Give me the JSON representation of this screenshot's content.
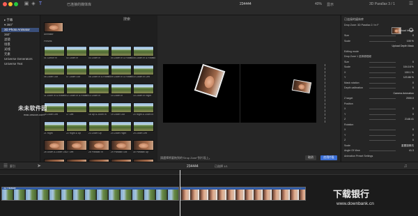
{
  "colors": {
    "accent": "#3b6fd6",
    "selection": "#3a4f7a",
    "clip": "#2e5aa6",
    "timecode": "#9a9a9a"
  },
  "titlebar": {
    "library_title": "已连接的媒体库",
    "timecode": "234444",
    "zoom": "40%",
    "view_label": "显示",
    "inspector_title": "3D Parallax 3 / 1"
  },
  "sidebar": {
    "items": [
      {
        "label": "字幕",
        "icon": "text-icon"
      },
      {
        "label": "360°",
        "icon": "globe-icon"
      },
      {
        "label": "3D Photo Animator",
        "icon": "folder-icon"
      },
      {
        "label": "360°"
      },
      {
        "label": "滤镜"
      },
      {
        "label": "场景"
      },
      {
        "label": "光线"
      },
      {
        "label": "元素"
      },
      {
        "label": "Universe Generators"
      },
      {
        "label": "Universe Text"
      }
    ]
  },
  "browser": {
    "search_placeholder": "搜索",
    "preview_label": "Animator",
    "section": "Presets",
    "rows": [
      {
        "kind": "land",
        "captions": [
          "01 Cursor In",
          "02 Zoom In",
          "03 Zoom In",
          "04 Zoom In & Rotation Right",
          "05 Zoom In & Rotation Right"
        ]
      },
      {
        "kind": "land",
        "captions": [
          "06 Zoom Out",
          "07 Zoom Out",
          "08 Zoom In & Rotation Left",
          "09 Zoom In & Rotation Left",
          "10 Zoom In Left"
        ]
      },
      {
        "kind": "land",
        "captions": [
          "11 Zoom In & Rotation",
          "12 Zoom In & Rotation",
          "13 Zoom In",
          "14 Zoom In",
          "15 Zoom In Right"
        ]
      },
      {
        "kind": "land",
        "captions": [
          "16 Zoom Left",
          "17 Left",
          "18 Up & Zoom In",
          "19 Zoom Out",
          "20 Right & Zoom In"
        ]
      },
      {
        "kind": "land",
        "captions": [
          "21 Right",
          "22 Right & Up",
          "23 Zoom Up",
          "24 Zoom Right",
          "25 Zoom Left"
        ]
      },
      {
        "kind": "face",
        "captions": [
          "26 Down & Zoom Out",
          "27 Left",
          "28 Parallax In",
          "29 Parallax Out",
          "30 Parallax Up"
        ]
      },
      {
        "kind": "face",
        "captions": [
          "31 Parallax L1",
          "32 Parallax Le",
          "33 Parallax Zo",
          "34 Parallax In",
          "35 Parallax Rt"
        ]
      }
    ]
  },
  "viewer": {
    "hint": "請選擇將要拖到的\"Drop Zone\"到片段上。",
    "apply_label": "取消",
    "done_label": "应用片段"
  },
  "inspector": {
    "header": "已连接的媒体库",
    "rows": [
      {
        "label": "Drop Zone: 3D Parallax 2 / in F",
        "value": ""
      },
      {
        "label": "",
        "value": "Upload Image"
      },
      {
        "label": "Size",
        "value": "0"
      },
      {
        "label": "Scale",
        "value": "100 %"
      },
      {
        "label": "",
        "value": "Upload Depth Mask"
      },
      {
        "label": "Editing mode",
        "value": ""
      },
      {
        "label": "Drop Zone 1 选择源视频",
        "value": ""
      },
      {
        "label": "Size",
        "value": "0"
      },
      {
        "label": "Scale",
        "value": "104.16 %"
      },
      {
        "label": "X",
        "value": "100.1 %"
      },
      {
        "label": "Y",
        "value": "123.86 %"
      },
      {
        "label": "Mask rotation",
        "value": "0"
      },
      {
        "label": "Depth calibration",
        "value": "0"
      },
      {
        "label": "",
        "value": "Camera Animation"
      },
      {
        "label": "Z target",
        "value": "2000.0"
      },
      {
        "label": "Position",
        "value": ""
      },
      {
        "label": "X",
        "value": "0"
      },
      {
        "label": "Y",
        "value": "0"
      },
      {
        "label": "Z",
        "value": "2148.41"
      },
      {
        "label": "Rotation",
        "value": ""
      },
      {
        "label": "X",
        "value": "0"
      },
      {
        "label": "Y",
        "value": "0"
      },
      {
        "label": "Z",
        "value": "0"
      },
      {
        "label": "Scale",
        "value": "重置摄像机"
      },
      {
        "label": "Angle Of View",
        "value": "41.3"
      },
      {
        "label": "Animation Preset Settings",
        "value": ""
      }
    ]
  },
  "timeline": {
    "timecode": "234444",
    "clip_label": "已选择 1/1",
    "index_label": "索引",
    "clip_name": "3D Parallax"
  },
  "watermark": {
    "left_main": "未未软件园",
    "left_sub": "mac.orsoon.com",
    "right_main": "下载银行",
    "right_sub": "www.downbank.cn"
  }
}
